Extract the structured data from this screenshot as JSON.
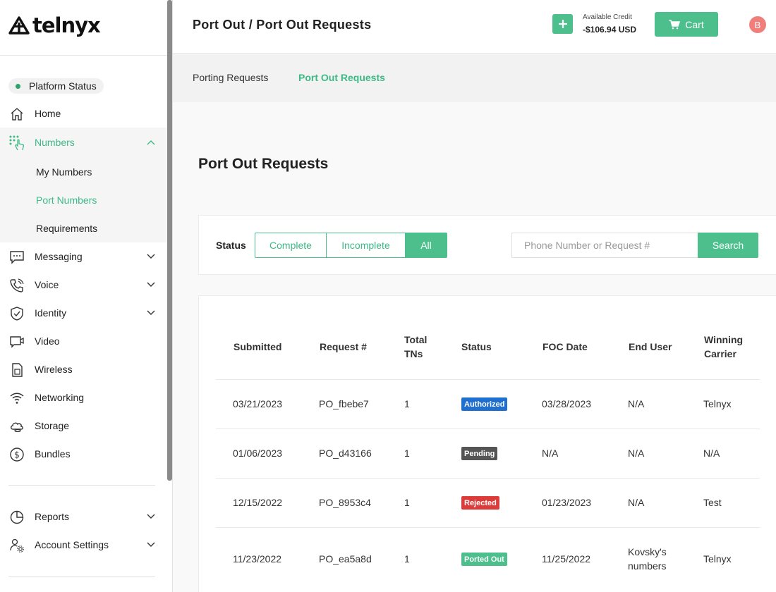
{
  "brand": {
    "logo_text": "telnyx"
  },
  "sidebar": {
    "platform_status": "Platform Status",
    "items": [
      {
        "label": "Home",
        "icon": "home-icon"
      },
      {
        "label": "Numbers",
        "icon": "numbers-icon"
      },
      {
        "label": "Messaging",
        "icon": "messaging-icon"
      },
      {
        "label": "Voice",
        "icon": "voice-icon"
      },
      {
        "label": "Identity",
        "icon": "identity-icon"
      },
      {
        "label": "Video",
        "icon": "video-icon"
      },
      {
        "label": "Wireless",
        "icon": "wireless-icon"
      },
      {
        "label": "Networking",
        "icon": "networking-icon"
      },
      {
        "label": "Storage",
        "icon": "storage-icon"
      },
      {
        "label": "Bundles",
        "icon": "bundles-icon"
      },
      {
        "label": "Reports",
        "icon": "reports-icon"
      },
      {
        "label": "Account Settings",
        "icon": "account-settings-icon"
      }
    ],
    "numbers_sub": [
      "My Numbers",
      "Port Numbers",
      "Requirements"
    ]
  },
  "header": {
    "title": "Port Out / Port Out Requests",
    "credit_label": "Available Credit",
    "credit_value": "-$106.94 USD",
    "cart_label": "Cart",
    "avatar_initial": "B"
  },
  "tabs": [
    "Porting Requests",
    "Port Out Requests"
  ],
  "main": {
    "section_title": "Port Out Requests",
    "filter": {
      "status_label": "Status",
      "options": [
        "Complete",
        "Incomplete",
        "All"
      ],
      "selected": "All",
      "search_placeholder": "Phone Number or Request #",
      "search_button": "Search"
    },
    "table": {
      "headers": [
        "Submitted",
        "Request #",
        "Total TNs",
        "Status",
        "FOC Date",
        "End User",
        "Winning Carrier"
      ],
      "rows": [
        {
          "submitted": "03/21/2023",
          "request": "PO_fbebe7",
          "total": "1",
          "status": "Authorized",
          "foc": "03/28/2023",
          "end_user": "N/A",
          "carrier": "Telnyx"
        },
        {
          "submitted": "01/06/2023",
          "request": "PO_d43166",
          "total": "1",
          "status": "Pending",
          "foc": "N/A",
          "end_user": "N/A",
          "carrier": "N/A"
        },
        {
          "submitted": "12/15/2022",
          "request": "PO_8953c4",
          "total": "1",
          "status": "Rejected",
          "foc": "01/23/2023",
          "end_user": "N/A",
          "carrier": "Test"
        },
        {
          "submitted": "11/23/2022",
          "request": "PO_ea5a8d",
          "total": "1",
          "status": "Ported Out",
          "foc": "11/25/2022",
          "end_user": "Kovsky's numbers",
          "carrier": "Telnyx"
        }
      ]
    }
  },
  "colors": {
    "accent": "#4cbf8c",
    "authorized": "#1e6fd0",
    "pending": "#555555",
    "rejected": "#dd3a3a",
    "ported_out": "#4cbf8c",
    "avatar": "#f07f7b"
  }
}
